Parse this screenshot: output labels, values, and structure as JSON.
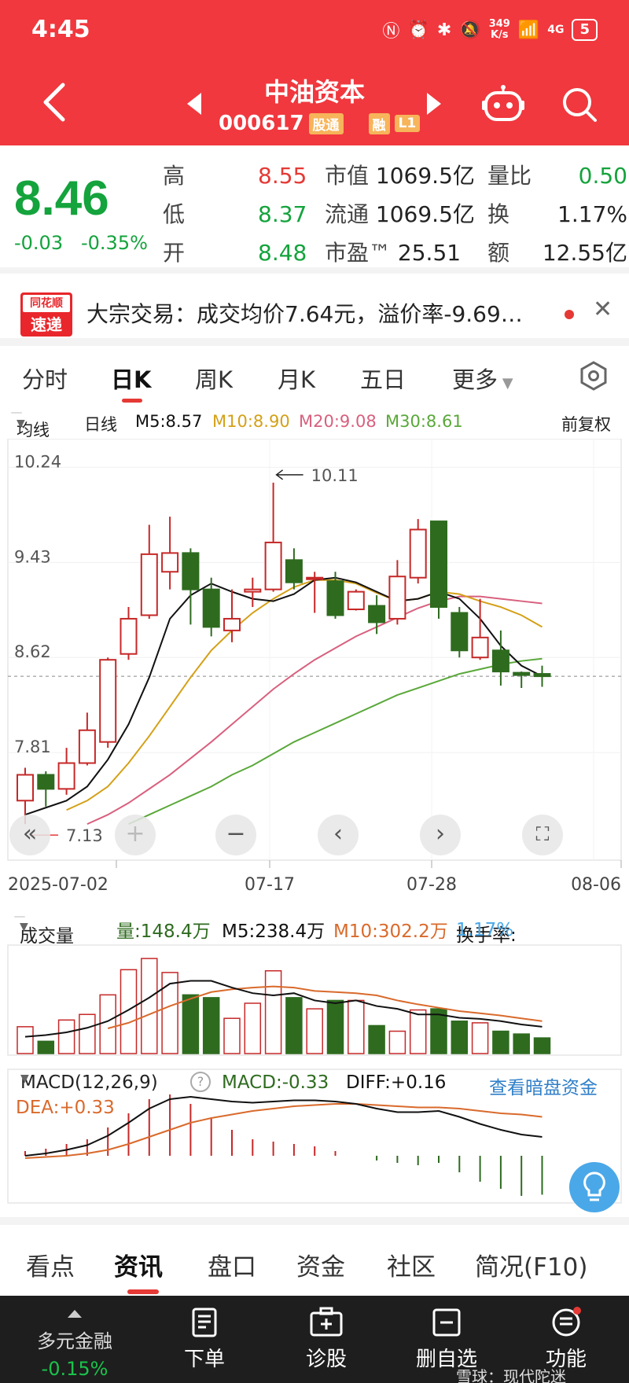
{
  "status": {
    "time": "4:45",
    "speed_top": "349",
    "speed_bottom": "K/s",
    "signal": "4G",
    "battery": "5"
  },
  "header": {
    "name": "中油资本",
    "code": "000617",
    "tag1": "股通",
    "tag2": "融",
    "tag3": "L1"
  },
  "quote": {
    "price": "8.46",
    "change": "-0.03",
    "change_pct": "-0.35%",
    "high_label": "高",
    "high": "8.55",
    "low_label": "低",
    "low": "8.37",
    "open_label": "开",
    "open": "8.48",
    "mcap_label": "市值",
    "mcap": "1069.5亿",
    "float_label": "流通",
    "float": "1069.5亿",
    "pe_label": "市盈™",
    "pe": "25.51",
    "vr_label": "量比",
    "vr": "0.50",
    "turn_label": "换",
    "turn": "1.17%",
    "amt_label": "额",
    "amt": "12.55亿"
  },
  "news": {
    "logo_top": "同花顺",
    "logo_bottom": "速递",
    "text": "大宗交易：成交均价7.64元，溢价率-9.69…"
  },
  "period_tabs": [
    "分时",
    "日K",
    "周K",
    "月K",
    "五日",
    "更多"
  ],
  "ma_legend": {
    "mode": "均线",
    "type": "日线",
    "m5": "M5:8.57",
    "m10": "M10:8.90",
    "m20": "M20:9.08",
    "m30": "M30:8.61",
    "adjust": "前复权"
  },
  "colors": {
    "header": "#f0383e",
    "up": "#c62828",
    "down": "#2e6b1f",
    "m5": "#111111",
    "m10": "#d4a017",
    "m20": "#d8607e",
    "m30": "#5aa83a"
  },
  "vol_legend": {
    "mode": "成交量",
    "vol": "量:148.4万",
    "m5": "M5:238.4万",
    "m10": "M10:302.2万",
    "turn_label": "换手率:",
    "turn": "1.17%"
  },
  "macd_legend": {
    "title": "MACD(12,26,9)",
    "macd": "MACD:-0.33",
    "diff": "DIFF:+0.16",
    "dea": "DEA:+0.33",
    "link": "查看暗盘资金"
  },
  "bottom_tabs": [
    "看点",
    "资讯",
    "盘口",
    "资金",
    "社区",
    "简况(F10)"
  ],
  "bottom_nav": {
    "sector_name": "多元金融",
    "sector_change": "-0.15%",
    "order": "下单",
    "diagnose": "诊股",
    "remove_watch": "删自选",
    "function": "功能"
  },
  "watermark": "雪球：现代陀迷",
  "chart_data": {
    "type": "candlestick",
    "y_ticks": [
      "10.24",
      "9.43",
      "8.62",
      "7.81"
    ],
    "x_labels": [
      "2025-07-02",
      "07-17",
      "07-28",
      "08-06"
    ],
    "annotations": {
      "max": "10.11",
      "min": "7.13"
    },
    "ylim": [
      7.0,
      10.35
    ],
    "candles": [
      {
        "o": 7.4,
        "c": 7.62,
        "h": 7.68,
        "l": 7.2
      },
      {
        "o": 7.62,
        "c": 7.5,
        "h": 7.65,
        "l": 7.35
      },
      {
        "o": 7.5,
        "c": 7.72,
        "h": 7.85,
        "l": 7.45
      },
      {
        "o": 7.72,
        "c": 8.0,
        "h": 8.15,
        "l": 7.7
      },
      {
        "o": 7.9,
        "c": 8.6,
        "h": 8.62,
        "l": 7.85
      },
      {
        "o": 8.65,
        "c": 8.95,
        "h": 9.05,
        "l": 8.6
      },
      {
        "o": 8.98,
        "c": 9.5,
        "h": 9.75,
        "l": 8.95
      },
      {
        "o": 9.35,
        "c": 9.51,
        "h": 9.82,
        "l": 9.2
      },
      {
        "o": 9.51,
        "c": 9.2,
        "h": 9.55,
        "l": 8.9
      },
      {
        "o": 9.2,
        "c": 8.88,
        "h": 9.3,
        "l": 8.8
      },
      {
        "o": 8.85,
        "c": 8.95,
        "h": 9.2,
        "l": 8.75
      },
      {
        "o": 9.18,
        "c": 9.2,
        "h": 9.3,
        "l": 9.05
      },
      {
        "o": 9.2,
        "c": 9.6,
        "h": 10.11,
        "l": 9.18
      },
      {
        "o": 9.45,
        "c": 9.26,
        "h": 9.55,
        "l": 9.2
      },
      {
        "o": 9.3,
        "c": 9.3,
        "h": 9.35,
        "l": 9.0
      },
      {
        "o": 9.27,
        "c": 8.98,
        "h": 9.35,
        "l": 8.95
      },
      {
        "o": 9.03,
        "c": 9.18,
        "h": 9.2,
        "l": 9.02
      },
      {
        "o": 9.06,
        "c": 8.92,
        "h": 9.15,
        "l": 8.82
      },
      {
        "o": 8.95,
        "c": 9.31,
        "h": 9.45,
        "l": 8.9
      },
      {
        "o": 9.3,
        "c": 9.71,
        "h": 9.8,
        "l": 9.25
      },
      {
        "o": 9.78,
        "c": 9.05,
        "h": 9.78,
        "l": 8.95
      },
      {
        "o": 9.0,
        "c": 8.68,
        "h": 9.05,
        "l": 8.62
      },
      {
        "o": 8.62,
        "c": 8.79,
        "h": 9.12,
        "l": 8.6
      },
      {
        "o": 8.68,
        "c": 8.5,
        "h": 8.85,
        "l": 8.38
      },
      {
        "o": 8.49,
        "c": 8.47,
        "h": 8.5,
        "l": 8.36
      },
      {
        "o": 8.48,
        "c": 8.46,
        "h": 8.55,
        "l": 8.37
      }
    ],
    "ma5": [
      7.28,
      7.34,
      7.4,
      7.52,
      7.75,
      8.05,
      8.45,
      8.95,
      9.15,
      9.25,
      9.18,
      9.12,
      9.1,
      9.16,
      9.28,
      9.3,
      9.26,
      9.18,
      9.1,
      9.12,
      9.18,
      9.12,
      8.95,
      8.72,
      8.55,
      8.46
    ],
    "ma10": [
      null,
      null,
      7.32,
      7.4,
      7.52,
      7.72,
      7.95,
      8.2,
      8.45,
      8.68,
      8.85,
      9.0,
      9.12,
      9.22,
      9.28,
      9.28,
      9.25,
      9.17,
      9.1,
      9.12,
      9.18,
      9.16,
      9.1,
      9.05,
      8.98,
      8.88
    ],
    "ma20": [
      null,
      null,
      null,
      7.2,
      7.28,
      7.38,
      7.5,
      7.62,
      7.76,
      7.9,
      8.05,
      8.2,
      8.35,
      8.48,
      8.6,
      8.7,
      8.8,
      8.88,
      8.96,
      9.04,
      9.1,
      9.14,
      9.14,
      9.12,
      9.1,
      9.08
    ],
    "ma30": [
      null,
      null,
      null,
      null,
      null,
      7.2,
      7.28,
      7.36,
      7.44,
      7.52,
      7.62,
      7.7,
      7.8,
      7.9,
      7.98,
      8.06,
      8.14,
      8.22,
      8.3,
      8.36,
      8.42,
      8.48,
      8.52,
      8.56,
      8.59,
      8.61
    ],
    "volume": [
      48,
      22,
      60,
      70,
      105,
      150,
      170,
      145,
      105,
      100,
      63,
      90,
      148,
      100,
      80,
      95,
      95,
      50,
      40,
      78,
      80,
      58,
      55,
      40,
      35,
      28
    ],
    "vol_m5": [
      30,
      33,
      38,
      46,
      58,
      78,
      100,
      125,
      130,
      130,
      118,
      108,
      104,
      108,
      95,
      90,
      95,
      85,
      80,
      70,
      70,
      64,
      62,
      58,
      52,
      48
    ],
    "vol_m10": [
      null,
      null,
      null,
      null,
      45,
      55,
      70,
      85,
      98,
      110,
      115,
      118,
      120,
      118,
      112,
      110,
      108,
      104,
      95,
      88,
      82,
      76,
      72,
      68,
      63,
      58
    ],
    "diff": [
      0.0,
      0.02,
      0.05,
      0.09,
      0.17,
      0.28,
      0.4,
      0.48,
      0.5,
      0.48,
      0.46,
      0.45,
      0.46,
      0.47,
      0.47,
      0.46,
      0.44,
      0.4,
      0.37,
      0.37,
      0.38,
      0.33,
      0.27,
      0.22,
      0.18,
      0.16
    ],
    "dea": [
      -0.02,
      -0.01,
      0.0,
      0.02,
      0.05,
      0.1,
      0.16,
      0.22,
      0.28,
      0.32,
      0.35,
      0.38,
      0.4,
      0.42,
      0.43,
      0.44,
      0.44,
      0.43,
      0.42,
      0.41,
      0.41,
      0.4,
      0.38,
      0.36,
      0.35,
      0.33
    ],
    "macd_hist": [
      0.04,
      0.06,
      0.1,
      0.14,
      0.24,
      0.36,
      0.48,
      0.52,
      0.44,
      0.32,
      0.22,
      0.14,
      0.12,
      0.1,
      0.08,
      0.04,
      0.0,
      -0.04,
      -0.06,
      -0.08,
      -0.06,
      -0.14,
      -0.22,
      -0.28,
      -0.34,
      -0.33
    ]
  }
}
